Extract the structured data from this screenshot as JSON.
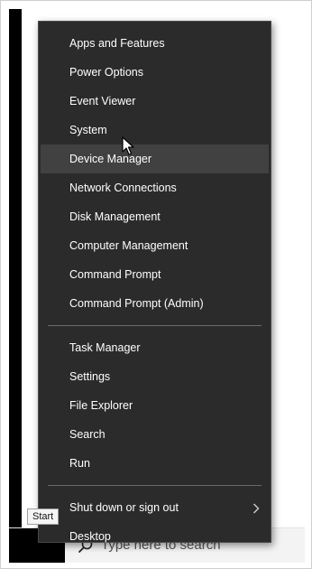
{
  "winx_menu": {
    "group1": [
      {
        "name": "apps-and-features",
        "label": "Apps and Features"
      },
      {
        "name": "power-options",
        "label": "Power Options"
      },
      {
        "name": "event-viewer",
        "label": "Event Viewer"
      },
      {
        "name": "system",
        "label": "System"
      },
      {
        "name": "device-manager",
        "label": "Device Manager"
      },
      {
        "name": "network-connections",
        "label": "Network Connections"
      },
      {
        "name": "disk-management",
        "label": "Disk Management"
      },
      {
        "name": "computer-management",
        "label": "Computer Management"
      },
      {
        "name": "command-prompt",
        "label": "Command Prompt"
      },
      {
        "name": "command-prompt-admin",
        "label": "Command Prompt (Admin)"
      }
    ],
    "group2": [
      {
        "name": "task-manager",
        "label": "Task Manager"
      },
      {
        "name": "settings",
        "label": "Settings"
      },
      {
        "name": "file-explorer",
        "label": "File Explorer"
      },
      {
        "name": "search",
        "label": "Search"
      },
      {
        "name": "run",
        "label": "Run"
      }
    ],
    "group3": [
      {
        "name": "shutdown-or-sign-out",
        "label": "Shut down or sign out",
        "has_submenu": true
      },
      {
        "name": "desktop",
        "label": "Desktop"
      }
    ],
    "hovered_item": "Device Manager"
  },
  "taskbar": {
    "start_tooltip": "Start",
    "search_placeholder": "Type here to search"
  },
  "icons": {
    "submenu": "chevron-right-icon",
    "search": "search-icon",
    "cursor": "mouse-pointer-icon"
  },
  "colors": {
    "menu_background": "#2b2b2b",
    "menu_hover": "#414141",
    "menu_text": "#ffffff",
    "separator": "#6a6a6a",
    "taskbar": "#f3f3f3"
  }
}
